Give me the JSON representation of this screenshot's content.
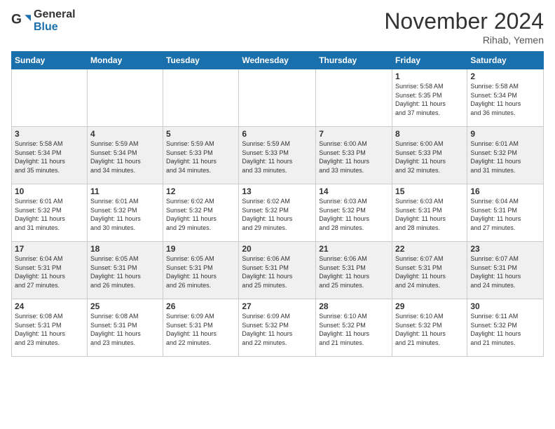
{
  "logo": {
    "general": "General",
    "blue": "Blue"
  },
  "header": {
    "month": "November 2024",
    "location": "Rihab, Yemen"
  },
  "weekdays": [
    "Sunday",
    "Monday",
    "Tuesday",
    "Wednesday",
    "Thursday",
    "Friday",
    "Saturday"
  ],
  "weeks": [
    [
      {
        "day": "",
        "info": ""
      },
      {
        "day": "",
        "info": ""
      },
      {
        "day": "",
        "info": ""
      },
      {
        "day": "",
        "info": ""
      },
      {
        "day": "",
        "info": ""
      },
      {
        "day": "1",
        "info": "Sunrise: 5:58 AM\nSunset: 5:35 PM\nDaylight: 11 hours\nand 37 minutes."
      },
      {
        "day": "2",
        "info": "Sunrise: 5:58 AM\nSunset: 5:34 PM\nDaylight: 11 hours\nand 36 minutes."
      }
    ],
    [
      {
        "day": "3",
        "info": "Sunrise: 5:58 AM\nSunset: 5:34 PM\nDaylight: 11 hours\nand 35 minutes."
      },
      {
        "day": "4",
        "info": "Sunrise: 5:59 AM\nSunset: 5:34 PM\nDaylight: 11 hours\nand 34 minutes."
      },
      {
        "day": "5",
        "info": "Sunrise: 5:59 AM\nSunset: 5:33 PM\nDaylight: 11 hours\nand 34 minutes."
      },
      {
        "day": "6",
        "info": "Sunrise: 5:59 AM\nSunset: 5:33 PM\nDaylight: 11 hours\nand 33 minutes."
      },
      {
        "day": "7",
        "info": "Sunrise: 6:00 AM\nSunset: 5:33 PM\nDaylight: 11 hours\nand 33 minutes."
      },
      {
        "day": "8",
        "info": "Sunrise: 6:00 AM\nSunset: 5:33 PM\nDaylight: 11 hours\nand 32 minutes."
      },
      {
        "day": "9",
        "info": "Sunrise: 6:01 AM\nSunset: 5:32 PM\nDaylight: 11 hours\nand 31 minutes."
      }
    ],
    [
      {
        "day": "10",
        "info": "Sunrise: 6:01 AM\nSunset: 5:32 PM\nDaylight: 11 hours\nand 31 minutes."
      },
      {
        "day": "11",
        "info": "Sunrise: 6:01 AM\nSunset: 5:32 PM\nDaylight: 11 hours\nand 30 minutes."
      },
      {
        "day": "12",
        "info": "Sunrise: 6:02 AM\nSunset: 5:32 PM\nDaylight: 11 hours\nand 29 minutes."
      },
      {
        "day": "13",
        "info": "Sunrise: 6:02 AM\nSunset: 5:32 PM\nDaylight: 11 hours\nand 29 minutes."
      },
      {
        "day": "14",
        "info": "Sunrise: 6:03 AM\nSunset: 5:32 PM\nDaylight: 11 hours\nand 28 minutes."
      },
      {
        "day": "15",
        "info": "Sunrise: 6:03 AM\nSunset: 5:31 PM\nDaylight: 11 hours\nand 28 minutes."
      },
      {
        "day": "16",
        "info": "Sunrise: 6:04 AM\nSunset: 5:31 PM\nDaylight: 11 hours\nand 27 minutes."
      }
    ],
    [
      {
        "day": "17",
        "info": "Sunrise: 6:04 AM\nSunset: 5:31 PM\nDaylight: 11 hours\nand 27 minutes."
      },
      {
        "day": "18",
        "info": "Sunrise: 6:05 AM\nSunset: 5:31 PM\nDaylight: 11 hours\nand 26 minutes."
      },
      {
        "day": "19",
        "info": "Sunrise: 6:05 AM\nSunset: 5:31 PM\nDaylight: 11 hours\nand 26 minutes."
      },
      {
        "day": "20",
        "info": "Sunrise: 6:06 AM\nSunset: 5:31 PM\nDaylight: 11 hours\nand 25 minutes."
      },
      {
        "day": "21",
        "info": "Sunrise: 6:06 AM\nSunset: 5:31 PM\nDaylight: 11 hours\nand 25 minutes."
      },
      {
        "day": "22",
        "info": "Sunrise: 6:07 AM\nSunset: 5:31 PM\nDaylight: 11 hours\nand 24 minutes."
      },
      {
        "day": "23",
        "info": "Sunrise: 6:07 AM\nSunset: 5:31 PM\nDaylight: 11 hours\nand 24 minutes."
      }
    ],
    [
      {
        "day": "24",
        "info": "Sunrise: 6:08 AM\nSunset: 5:31 PM\nDaylight: 11 hours\nand 23 minutes."
      },
      {
        "day": "25",
        "info": "Sunrise: 6:08 AM\nSunset: 5:31 PM\nDaylight: 11 hours\nand 23 minutes."
      },
      {
        "day": "26",
        "info": "Sunrise: 6:09 AM\nSunset: 5:31 PM\nDaylight: 11 hours\nand 22 minutes."
      },
      {
        "day": "27",
        "info": "Sunrise: 6:09 AM\nSunset: 5:32 PM\nDaylight: 11 hours\nand 22 minutes."
      },
      {
        "day": "28",
        "info": "Sunrise: 6:10 AM\nSunset: 5:32 PM\nDaylight: 11 hours\nand 21 minutes."
      },
      {
        "day": "29",
        "info": "Sunrise: 6:10 AM\nSunset: 5:32 PM\nDaylight: 11 hours\nand 21 minutes."
      },
      {
        "day": "30",
        "info": "Sunrise: 6:11 AM\nSunset: 5:32 PM\nDaylight: 11 hours\nand 21 minutes."
      }
    ]
  ]
}
